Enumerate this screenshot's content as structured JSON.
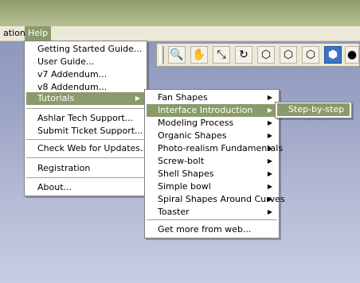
{
  "menubar": {
    "item_prev": "ation",
    "item_help": "Help"
  },
  "help_menu": {
    "items": [
      {
        "label": "Getting Started Guide..."
      },
      {
        "label": "User Guide..."
      },
      {
        "label": "v7 Addendum..."
      },
      {
        "label": "v8 Addendum..."
      },
      {
        "label": "Tutorials"
      },
      {
        "label": "Ashlar Tech Support..."
      },
      {
        "label": "Submit Ticket Support..."
      },
      {
        "label": "Check Web for Updates..."
      },
      {
        "label": "Registration"
      },
      {
        "label": "About..."
      }
    ]
  },
  "tutorials_menu": {
    "items": [
      {
        "label": "Fan Shapes"
      },
      {
        "label": "Interface Introduction"
      },
      {
        "label": "Modeling Process"
      },
      {
        "label": "Organic Shapes"
      },
      {
        "label": "Photo-realism Fundamentals"
      },
      {
        "label": "Screw-bolt"
      },
      {
        "label": "Shell Shapes"
      },
      {
        "label": "Simple bowl"
      },
      {
        "label": "Spiral Shapes Around Curves"
      },
      {
        "label": "Toaster"
      },
      {
        "label": "Get more from web..."
      }
    ]
  },
  "interface_menu": {
    "items": [
      {
        "label": "Step-by-step"
      }
    ]
  },
  "toolbar": {
    "icons": [
      "zoom-icon",
      "hand-pan-icon",
      "scale-icon",
      "rotate-view-icon",
      "wireframe-cube-icon",
      "hidden-line-cube-icon",
      "outline-cube-icon",
      "shaded-cube-icon",
      "render-sphere-icon"
    ]
  },
  "colors": {
    "highlight": "#8a9a6b",
    "titlebar": "#a7b183",
    "workspace": "#9aa2c4"
  }
}
